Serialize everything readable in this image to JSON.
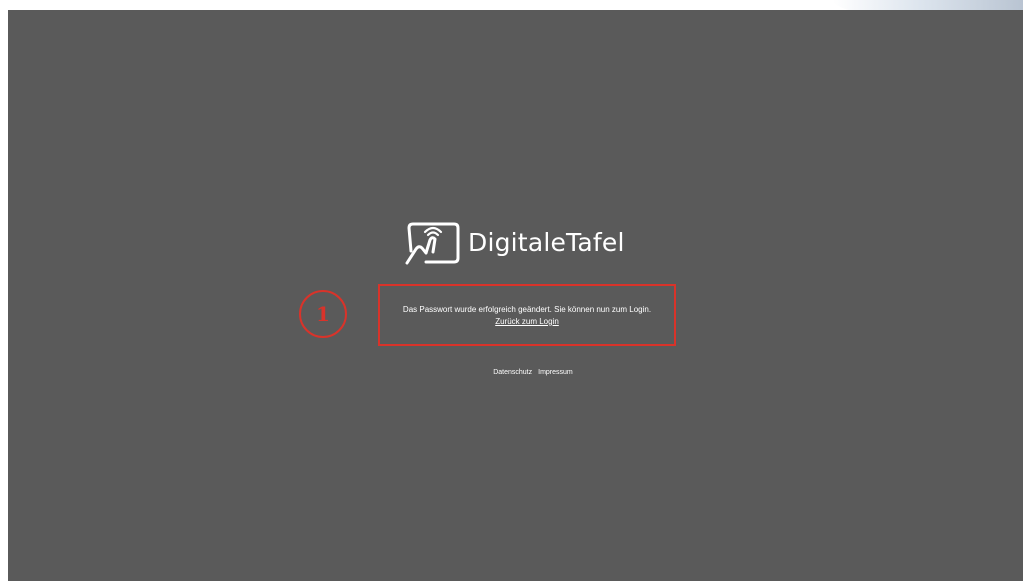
{
  "logo": {
    "text": "DigitaleTafel",
    "icon": "touch-screen-hand-icon"
  },
  "message": {
    "text": "Das Passwort wurde erfolgreich geändert. Sie können nun zum Login.",
    "link_label": "Zurück zum Login"
  },
  "annotation": {
    "step_number": "1"
  },
  "footer": {
    "links": [
      "Datenschutz",
      "Impressum"
    ]
  },
  "colors": {
    "background": "#5a5a5a",
    "text": "#ffffff",
    "annotation": "#d9332a"
  }
}
